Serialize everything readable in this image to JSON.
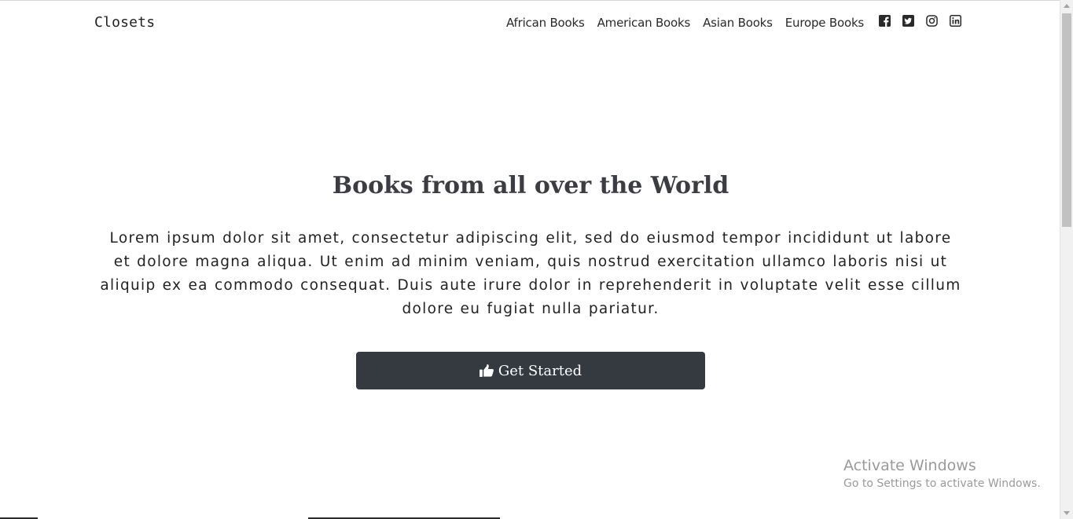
{
  "navbar": {
    "brand": "Closets",
    "links": [
      {
        "label": "African Books"
      },
      {
        "label": "American Books"
      },
      {
        "label": "Asian Books"
      },
      {
        "label": "Europe Books"
      }
    ],
    "social_icons": [
      "facebook-icon",
      "twitter-icon",
      "instagram-icon",
      "linkedin-icon"
    ]
  },
  "hero": {
    "title": "Books from all over the World",
    "text": "Lorem ipsum dolor sit amet, consectetur adipiscing elit, sed do eiusmod tempor incididunt ut labore et dolore magna aliqua. Ut enim ad minim veniam, quis nostrud exercitation ullamco laboris nisi ut aliquip ex ea commodo consequat. Duis aute irure dolor in reprehenderit in voluptate velit esse cillum dolore eu fugiat nulla pariatur.",
    "cta_label": "Get Started",
    "cta_icon": "thumbs-up-icon"
  },
  "watermark": {
    "title": "Activate Windows",
    "subtitle": "Go to Settings to activate Windows."
  },
  "colors": {
    "button_bg": "#343a40",
    "title": "#3b3d42",
    "watermark": "#9a9a9a"
  }
}
